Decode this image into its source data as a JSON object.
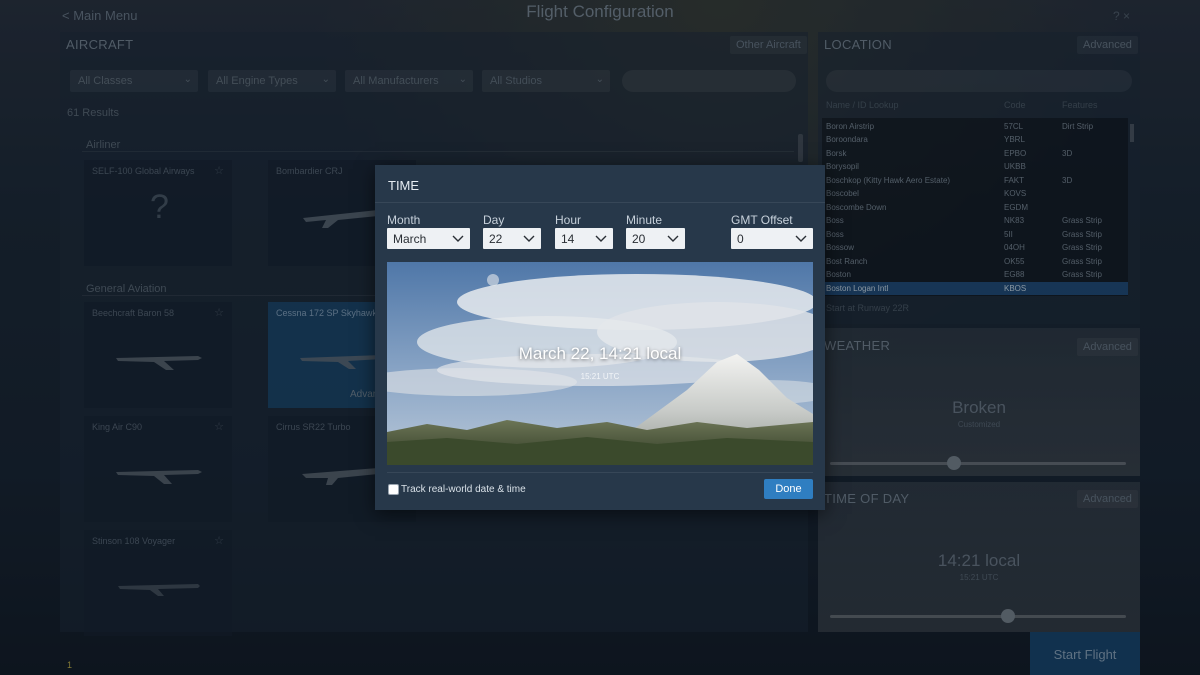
{
  "window": {
    "title": "Flight Configuration",
    "main_menu": "< Main Menu",
    "top_right": "?  ×"
  },
  "aircraft": {
    "section_title": "AIRCRAFT",
    "other_aircraft_label": "Other Aircraft",
    "filters": [
      "All Classes",
      "All Engine Types",
      "All Manufacturers",
      "All Studios"
    ],
    "results_label": "61 Results",
    "categories": [
      "Airliner",
      "General Aviation"
    ],
    "cards": [
      {
        "name": "SELF-100 Global Airways"
      },
      {
        "name": "Bombardier CRJ"
      },
      {
        "name": "Beechcraft Baron 58"
      },
      {
        "name": "Cessna 172 SP Skyhawk"
      },
      {
        "name": "King Air C90"
      },
      {
        "name": "Cirrus SR22 Turbo"
      },
      {
        "name": "Stinson 108 Voyager"
      }
    ],
    "selected_advanced_label": "Advanced"
  },
  "location": {
    "section_title": "LOCATION",
    "advanced_label": "Advanced",
    "columns": [
      "Name / ID Lookup",
      "Code",
      "Features"
    ],
    "airports": [
      {
        "name": "Boron Airstrip",
        "code": "57CL",
        "type": "Dirt Strip"
      },
      {
        "name": "Boroondara",
        "code": "YBRL",
        "type": ""
      },
      {
        "name": "Borsk",
        "code": "EPBO",
        "type": "3D"
      },
      {
        "name": "Borysopil",
        "code": "UKBB",
        "type": ""
      },
      {
        "name": "Boschkop (Kitty Hawk Aero Estate)",
        "code": "FAKT",
        "type": "3D"
      },
      {
        "name": "Boscobel",
        "code": "KOVS",
        "type": ""
      },
      {
        "name": "Boscombe Down",
        "code": "EGDM",
        "type": ""
      },
      {
        "name": "Boss",
        "code": "NK83",
        "type": "Grass Strip"
      },
      {
        "name": "Boss",
        "code": "5II",
        "type": "Grass Strip"
      },
      {
        "name": "Bossow",
        "code": "04OH",
        "type": "Grass Strip"
      },
      {
        "name": "Bost Ranch",
        "code": "OK55",
        "type": "Grass Strip"
      },
      {
        "name": "Boston",
        "code": "EG88",
        "type": "Grass Strip"
      },
      {
        "name": "Boston Logan Intl",
        "code": "KBOS",
        "type": ""
      }
    ],
    "runway_label": "Start at Runway 22R"
  },
  "weather": {
    "section_title": "WEATHER",
    "advanced_label": "Advanced",
    "value": "Broken",
    "sub": "Customized",
    "slider_fraction": 0.42
  },
  "time_of_day": {
    "section_title": "TIME OF DAY",
    "advanced_label": "Advanced",
    "value": "14:21 local",
    "sub": "15:21 UTC",
    "slider_fraction": 0.6
  },
  "start_flight_label": "Start Flight",
  "corner_number": "1",
  "time_dialog": {
    "title": "TIME",
    "fields": {
      "month": {
        "label": "Month",
        "value": "March"
      },
      "day": {
        "label": "Day",
        "value": "22"
      },
      "hour": {
        "label": "Hour",
        "value": "14"
      },
      "minute": {
        "label": "Minute",
        "value": "20"
      },
      "gmt": {
        "label": "GMT Offset",
        "value": "0"
      }
    },
    "preview_main": "March 22, 14:21 local",
    "preview_utc": "15:21 UTC",
    "track_label": "Track real-world date & time",
    "track_checked": false,
    "done_label": "Done"
  },
  "colors": {
    "accent": "#2f7ec1",
    "modal_bg": "#27384a"
  },
  "icons": {
    "select_arrow": "chevron-down-icon",
    "favorite": "star-icon",
    "unknown": "question-mark-icon"
  }
}
